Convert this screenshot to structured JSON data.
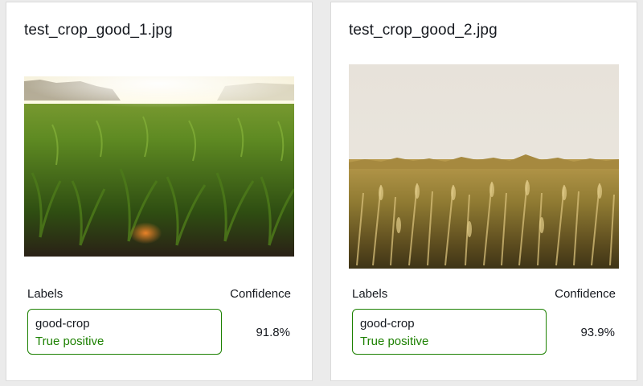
{
  "cards": [
    {
      "file_name": "test_crop_good_1.jpg",
      "labels_header": "Labels",
      "confidence_header": "Confidence",
      "label": "good-crop",
      "status": "True positive",
      "confidence": "91.8%"
    },
    {
      "file_name": "test_crop_good_2.jpg",
      "labels_header": "Labels",
      "confidence_header": "Confidence",
      "label": "good-crop",
      "status": "True positive",
      "confidence": "93.9%"
    }
  ],
  "colors": {
    "page_background": "#ebebeb",
    "card_background": "#ffffff",
    "status_green": "#1d8102",
    "text": "#16191f"
  }
}
